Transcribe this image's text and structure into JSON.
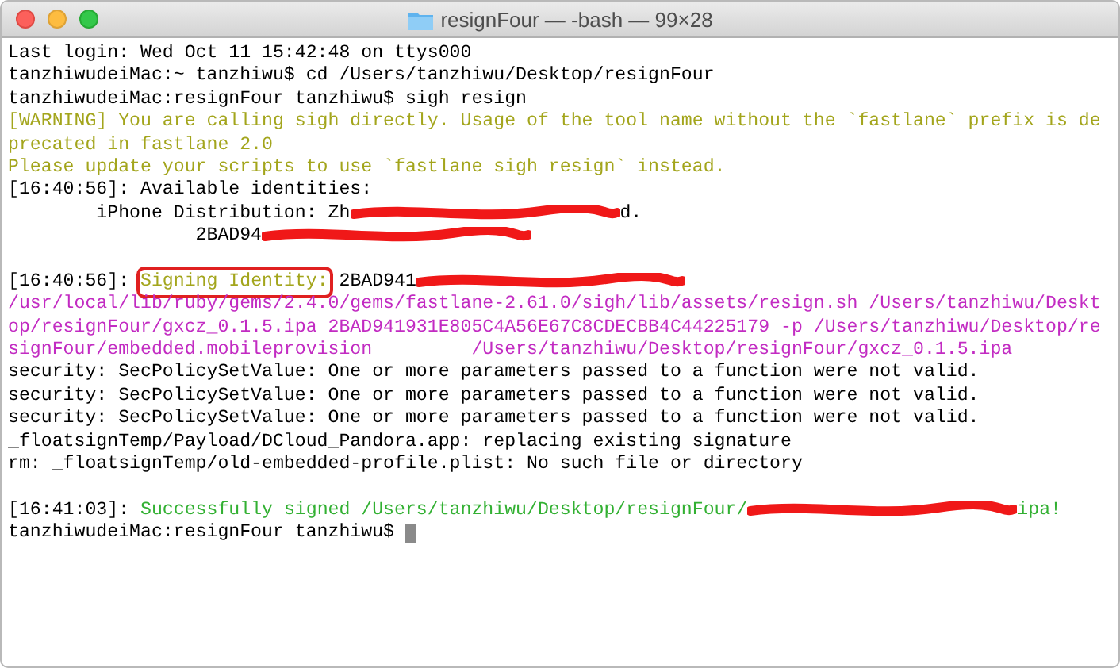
{
  "window": {
    "title": "resignFour — -bash — 99×28"
  },
  "terminal": {
    "lines": [
      {
        "kind": "plain",
        "segments": [
          {
            "kind": "text",
            "text": "Last login: Wed Oct 11 15:42:48 on ttys000"
          }
        ]
      },
      {
        "kind": "plain",
        "segments": [
          {
            "kind": "text",
            "text": "tanzhiwudeiMac:~ tanzhiwu$ cd /Users/tanzhiwu/Desktop/resignFour"
          }
        ]
      },
      {
        "kind": "plain",
        "segments": [
          {
            "kind": "text",
            "text": "tanzhiwudeiMac:resignFour tanzhiwu$ sigh resign"
          }
        ]
      },
      {
        "kind": "warning",
        "segments": [
          {
            "kind": "text",
            "text": "[WARNING] You are calling sigh directly. Usage of the tool name without the `fastlane` prefix is de"
          }
        ]
      },
      {
        "kind": "warning",
        "segments": [
          {
            "kind": "text",
            "text": "precated in fastlane 2.0"
          }
        ]
      },
      {
        "kind": "warning",
        "segments": [
          {
            "kind": "text",
            "text": "Please update your scripts to use `fastlane sigh resign` instead."
          }
        ]
      },
      {
        "kind": "plain",
        "segments": [
          {
            "kind": "text",
            "text": "[16:40:56]: Available identities:"
          }
        ]
      },
      {
        "kind": "plain",
        "segments": [
          {
            "kind": "text",
            "text": "        iPhone Distribution: Zh"
          },
          {
            "kind": "redaction"
          },
          {
            "kind": "text",
            "text": "d."
          }
        ]
      },
      {
        "kind": "plain",
        "segments": [
          {
            "kind": "text",
            "text": "                 2BAD94"
          },
          {
            "kind": "redaction"
          }
        ]
      },
      {
        "kind": "blank"
      },
      {
        "kind": "plain",
        "segments": [
          {
            "kind": "text",
            "text": "[16:40:56]: "
          },
          {
            "kind": "highlight",
            "text": "Signing Identity:"
          },
          {
            "kind": "text",
            "text": " 2BAD941"
          },
          {
            "kind": "redaction"
          }
        ]
      },
      {
        "kind": "path",
        "segments": [
          {
            "kind": "text",
            "text": "/usr/local/lib/ruby/gems/2.4.0/gems/fastlane-2.61.0/sigh/lib/assets/resign.sh /Users/tanzhiwu/Deskt"
          }
        ]
      },
      {
        "kind": "path",
        "segments": [
          {
            "kind": "text",
            "text": "op/resignFour/gxcz_0.1.5.ipa 2BAD941931E805C4A56E67C8CDECBB4C44225179 -p /Users/tanzhiwu/Desktop/re"
          }
        ]
      },
      {
        "kind": "path",
        "segments": [
          {
            "kind": "text",
            "text": "signFour/embedded.mobileprovision         /Users/tanzhiwu/Desktop/resignFour/gxcz_0.1.5.ipa"
          }
        ]
      },
      {
        "kind": "plain",
        "segments": [
          {
            "kind": "text",
            "text": "security: SecPolicySetValue: One or more parameters passed to a function were not valid."
          }
        ]
      },
      {
        "kind": "plain",
        "segments": [
          {
            "kind": "text",
            "text": "security: SecPolicySetValue: One or more parameters passed to a function were not valid."
          }
        ]
      },
      {
        "kind": "plain",
        "segments": [
          {
            "kind": "text",
            "text": "security: SecPolicySetValue: One or more parameters passed to a function were not valid."
          }
        ]
      },
      {
        "kind": "plain",
        "segments": [
          {
            "kind": "text",
            "text": "_floatsignTemp/Payload/DCloud_Pandora.app: replacing existing signature"
          }
        ]
      },
      {
        "kind": "plain",
        "segments": [
          {
            "kind": "text",
            "text": "rm: _floatsignTemp/old-embedded-profile.plist: No such file or directory"
          }
        ]
      },
      {
        "kind": "blank"
      },
      {
        "kind": "plain",
        "segments": [
          {
            "kind": "text",
            "text": "[16:41:03]: "
          },
          {
            "kind": "success",
            "text": "Successfully signed /Users/tanzhiwu/Desktop/resignFour/"
          },
          {
            "kind": "redaction"
          },
          {
            "kind": "success",
            "text": "ipa!"
          }
        ]
      },
      {
        "kind": "plain",
        "segments": [
          {
            "kind": "text",
            "text": "tanzhiwudeiMac:resignFour tanzhiwu$ "
          },
          {
            "kind": "cursor"
          }
        ]
      }
    ]
  }
}
